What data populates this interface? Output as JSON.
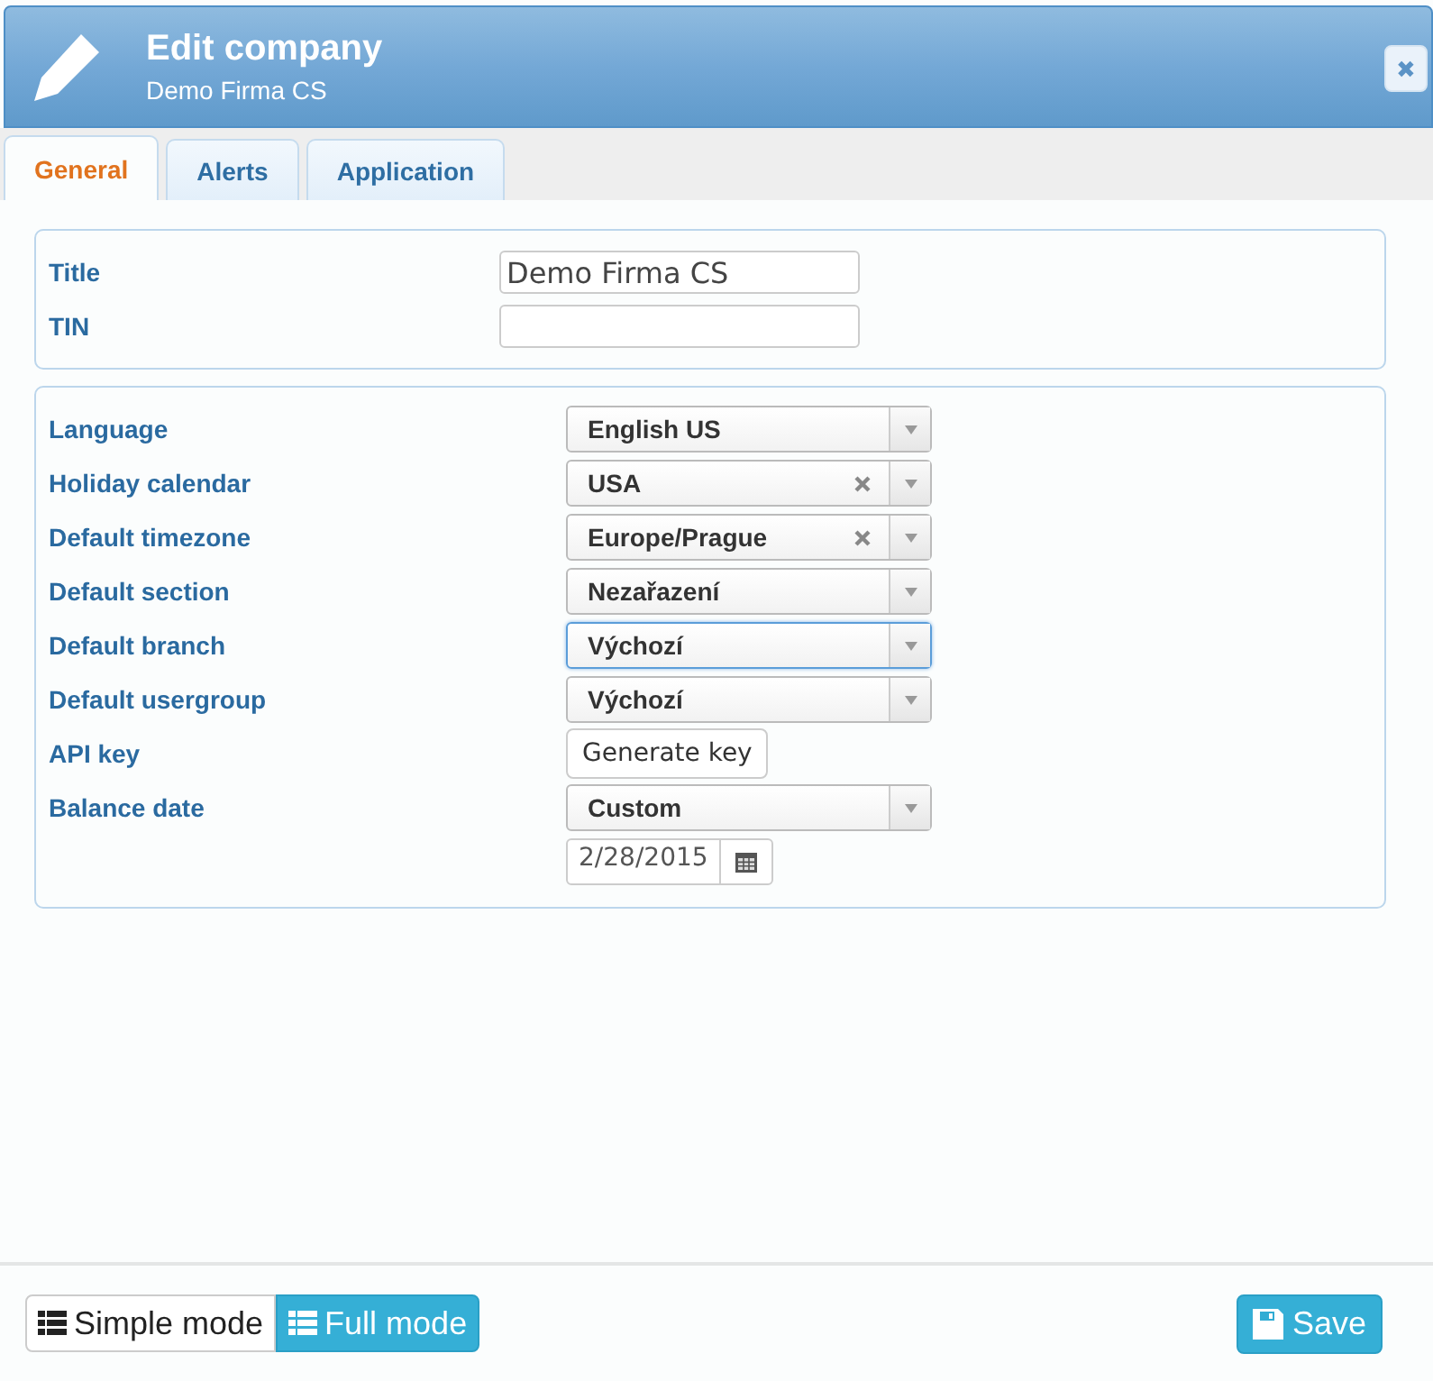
{
  "header": {
    "title": "Edit company",
    "subtitle": "Demo Firma CS",
    "close": "✖"
  },
  "tabs": [
    {
      "label": "General",
      "selected": true
    },
    {
      "label": "Alerts",
      "selected": false
    },
    {
      "label": "Application",
      "selected": false
    }
  ],
  "basic": [
    {
      "label": "Title",
      "value": "Demo Firma CS"
    },
    {
      "label": "TIN"
    }
  ],
  "settings": [
    {
      "kind": "select",
      "label": "Language",
      "value": "English US",
      "clearable": false,
      "focused": false
    },
    {
      "kind": "select",
      "label": "Holiday calendar",
      "value": "USA",
      "clearable": true,
      "focused": false
    },
    {
      "kind": "select",
      "label": "Default timezone",
      "value": "Europe/Prague",
      "clearable": true,
      "focused": false
    },
    {
      "kind": "select",
      "label": "Default section",
      "value": "Nezařazení",
      "clearable": false,
      "focused": false
    },
    {
      "kind": "select",
      "label": "Default branch",
      "value": "Výchozí",
      "clearable": false,
      "focused": true
    },
    {
      "kind": "select",
      "label": "Default usergroup",
      "value": "Výchozí",
      "clearable": false,
      "focused": false
    },
    {
      "kind": "button",
      "label": "API key",
      "value": "Generate key"
    },
    {
      "kind": "select",
      "label": "Balance date",
      "value": "Custom",
      "clearable": false,
      "focused": false
    },
    {
      "kind": "date",
      "value": "2/28/2015"
    }
  ],
  "modes": [
    {
      "label": "Simple mode",
      "selected": false
    },
    {
      "label": "Full mode",
      "selected": true
    }
  ],
  "save": "Save"
}
